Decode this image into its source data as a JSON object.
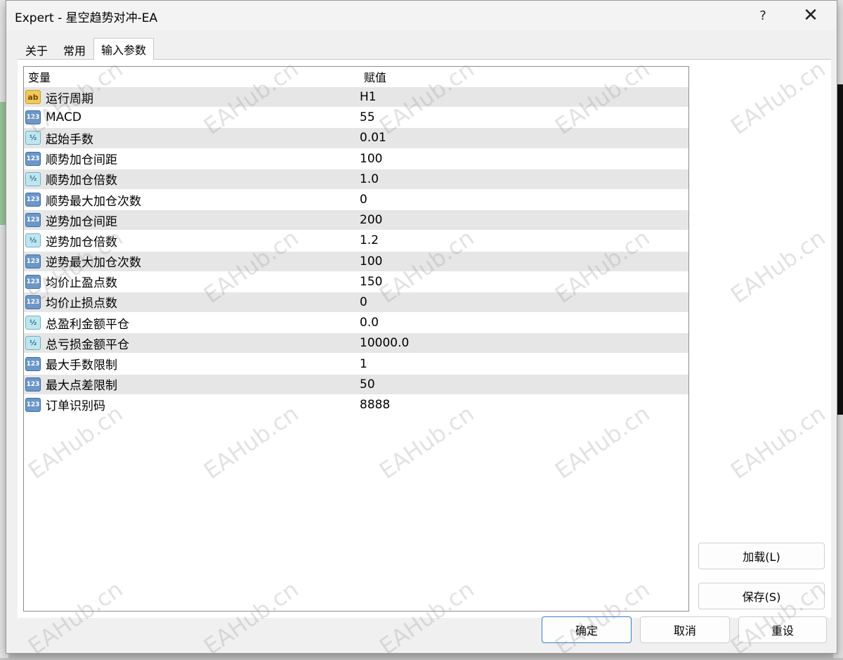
{
  "dialog": {
    "title": "Expert - 星空趋势对冲-EA",
    "help_label": "?",
    "close_label": "✕"
  },
  "tabs": [
    {
      "label": "关于",
      "active": false
    },
    {
      "label": "常用",
      "active": false
    },
    {
      "label": "输入参数",
      "active": true
    }
  ],
  "grid": {
    "headers": {
      "variable": "变量",
      "value": "赋值"
    },
    "rows": [
      {
        "type": "string",
        "icon": "ab",
        "name": "运行周期",
        "value": "H1"
      },
      {
        "type": "int",
        "icon": "123",
        "name": "MACD",
        "value": "55"
      },
      {
        "type": "double",
        "icon": "½",
        "name": "起始手数",
        "value": "0.01"
      },
      {
        "type": "int",
        "icon": "123",
        "name": "顺势加仓间距",
        "value": "100"
      },
      {
        "type": "double",
        "icon": "½",
        "name": "顺势加仓倍数",
        "value": "1.0"
      },
      {
        "type": "int",
        "icon": "123",
        "name": "顺势最大加仓次数",
        "value": "0"
      },
      {
        "type": "int",
        "icon": "123",
        "name": "逆势加仓间距",
        "value": "200"
      },
      {
        "type": "double",
        "icon": "½",
        "name": "逆势加仓倍数",
        "value": "1.2"
      },
      {
        "type": "int",
        "icon": "123",
        "name": "逆势最大加仓次数",
        "value": "100"
      },
      {
        "type": "int",
        "icon": "123",
        "name": "均价止盈点数",
        "value": "150"
      },
      {
        "type": "int",
        "icon": "123",
        "name": "均价止损点数",
        "value": "0"
      },
      {
        "type": "double",
        "icon": "½",
        "name": "总盈利金额平仓",
        "value": "0.0"
      },
      {
        "type": "double",
        "icon": "½",
        "name": "总亏损金额平仓",
        "value": "10000.0"
      },
      {
        "type": "int",
        "icon": "123",
        "name": "最大手数限制",
        "value": "1"
      },
      {
        "type": "int",
        "icon": "123",
        "name": "最大点差限制",
        "value": "50"
      },
      {
        "type": "int",
        "icon": "123",
        "name": "订单识别码",
        "value": "8888"
      }
    ]
  },
  "buttons": {
    "load": "加载(L)",
    "save": "保存(S)",
    "ok": "确定",
    "cancel": "取消",
    "reset": "重设"
  },
  "watermark": "EAHub.cn",
  "colors": {
    "accent_border": "#3b7cc9",
    "row_alt": "#e6e6e6",
    "dialog_bg": "#f0f0f0"
  }
}
